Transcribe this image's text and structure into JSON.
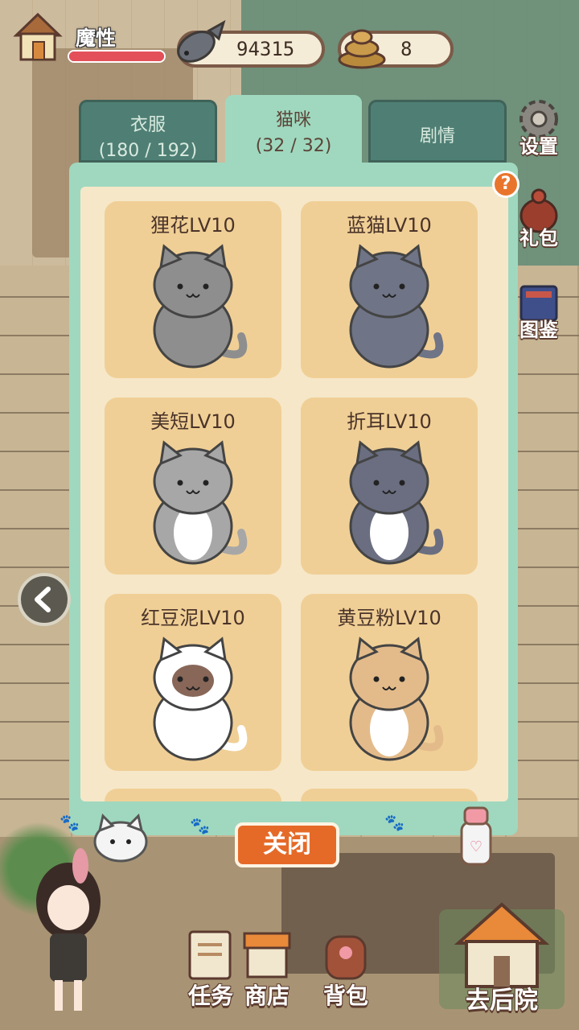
{
  "player": {
    "name": "魔性",
    "hp_fraction": 1.0
  },
  "currency": {
    "fish": "94315",
    "poop": "8"
  },
  "side_buttons": [
    {
      "label": "设置",
      "icon": "gear-icon"
    },
    {
      "label": "礼包",
      "icon": "gift-bag-icon"
    },
    {
      "label": "图鉴",
      "icon": "book-icon"
    }
  ],
  "tabs": [
    {
      "title": "衣服",
      "count": "(180 / 192)",
      "active": false
    },
    {
      "title": "猫咪",
      "count": "(32 / 32)",
      "active": true
    },
    {
      "title": "剧情",
      "count": "",
      "active": false
    }
  ],
  "help_label": "?",
  "cats": [
    {
      "label": "狸花LV10",
      "body": "#8e8e8e",
      "belly": "#8e8e8e",
      "patch": "none"
    },
    {
      "label": "蓝猫LV10",
      "body": "#6f7486",
      "belly": "#6f7486",
      "patch": "none"
    },
    {
      "label": "美短LV10",
      "body": "#a7a7a7",
      "belly": "#ffffff",
      "patch": "none"
    },
    {
      "label": "折耳LV10",
      "body": "#6a6e80",
      "belly": "#ffffff",
      "patch": "none"
    },
    {
      "label": "红豆泥LV10",
      "body": "#ffffff",
      "belly": "#ffffff",
      "patch": "#7b5646"
    },
    {
      "label": "黄豆粉LV10",
      "body": "#e3bb8a",
      "belly": "#ffffff",
      "patch": "none"
    }
  ],
  "close_label": "关闭",
  "bottom_nav": [
    {
      "label": "任务",
      "icon": "task-icon"
    },
    {
      "label": "商店",
      "icon": "shop-icon"
    },
    {
      "label": "背包",
      "icon": "backpack-icon"
    }
  ],
  "backyard_label": "去后院",
  "colors": {
    "accent_orange": "#e56a28",
    "panel_mint": "#9fd8bf",
    "card": "#f0cf96"
  }
}
